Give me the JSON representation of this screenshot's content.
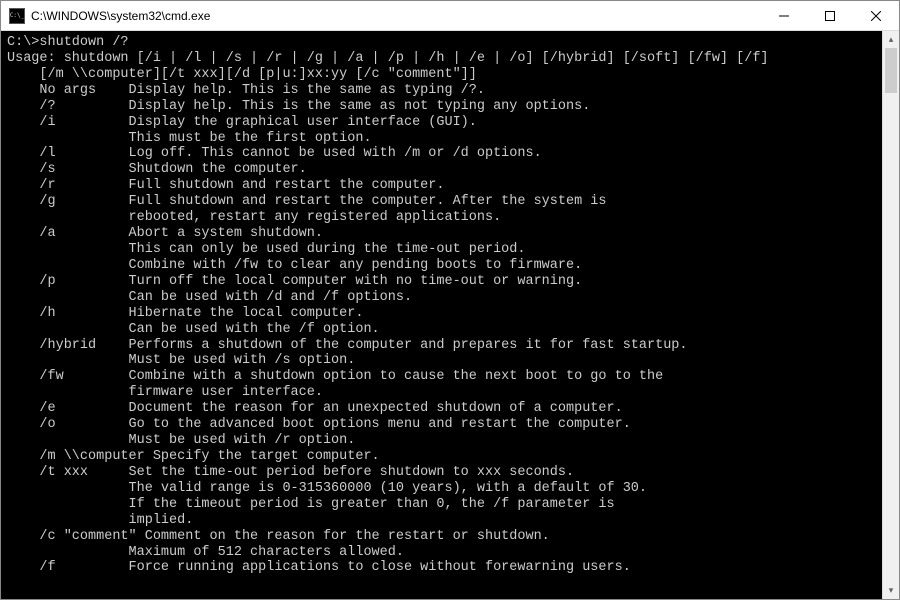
{
  "window": {
    "title": "C:\\WINDOWS\\system32\\cmd.exe"
  },
  "terminal": {
    "lines": [
      "",
      "C:\\>shutdown /?",
      "Usage: shutdown [/i | /l | /s | /r | /g | /a | /p | /h | /e | /o] [/hybrid] [/soft] [/fw] [/f]",
      "    [/m \\\\computer][/t xxx][/d [p|u:]xx:yy [/c \"comment\"]]",
      "",
      "    No args    Display help. This is the same as typing /?.",
      "    /?         Display help. This is the same as not typing any options.",
      "    /i         Display the graphical user interface (GUI).",
      "               This must be the first option.",
      "    /l         Log off. This cannot be used with /m or /d options.",
      "    /s         Shutdown the computer.",
      "    /r         Full shutdown and restart the computer.",
      "    /g         Full shutdown and restart the computer. After the system is",
      "               rebooted, restart any registered applications.",
      "    /a         Abort a system shutdown.",
      "               This can only be used during the time-out period.",
      "               Combine with /fw to clear any pending boots to firmware.",
      "    /p         Turn off the local computer with no time-out or warning.",
      "               Can be used with /d and /f options.",
      "    /h         Hibernate the local computer.",
      "               Can be used with the /f option.",
      "    /hybrid    Performs a shutdown of the computer and prepares it for fast startup.",
      "               Must be used with /s option.",
      "    /fw        Combine with a shutdown option to cause the next boot to go to the",
      "               firmware user interface.",
      "    /e         Document the reason for an unexpected shutdown of a computer.",
      "    /o         Go to the advanced boot options menu and restart the computer.",
      "               Must be used with /r option.",
      "    /m \\\\computer Specify the target computer.",
      "    /t xxx     Set the time-out period before shutdown to xxx seconds.",
      "               The valid range is 0-315360000 (10 years), with a default of 30.",
      "               If the timeout period is greater than 0, the /f parameter is",
      "               implied.",
      "    /c \"comment\" Comment on the reason for the restart or shutdown.",
      "               Maximum of 512 characters allowed.",
      "    /f         Force running applications to close without forewarning users."
    ]
  }
}
